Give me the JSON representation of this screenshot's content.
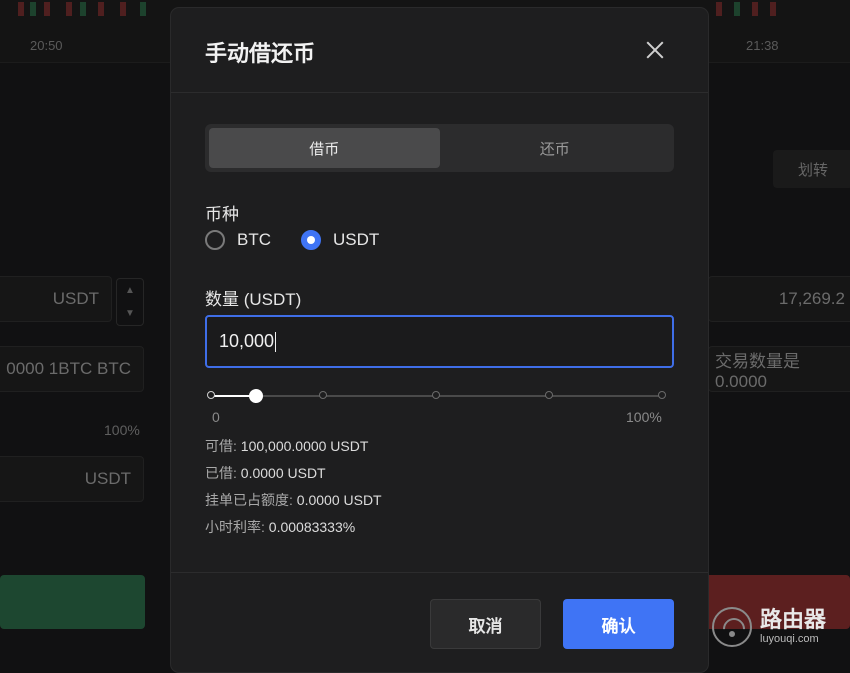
{
  "background": {
    "times": [
      "20:50",
      "21:38"
    ],
    "transfer_label": "划转",
    "rows": [
      {
        "left": "USDT",
        "right": "17,269.2"
      },
      {
        "left": "0000 1BTC  BTC",
        "right": "交易数量是0.0000"
      },
      {
        "left": "100%"
      },
      {
        "left": "USDT"
      }
    ]
  },
  "modal": {
    "title": "手动借还币",
    "close_label": "×",
    "tabs": [
      {
        "label": "借币",
        "active": true
      },
      {
        "label": "还币",
        "active": false
      }
    ],
    "currency_label": "币种",
    "currencies": [
      {
        "label": "BTC",
        "selected": false
      },
      {
        "label": "USDT",
        "selected": true
      }
    ],
    "amount_label": "数量 (USDT)",
    "amount_value": "10,000",
    "slider": {
      "min_label": "0",
      "max_label": "100%",
      "value_fraction": 0.1
    },
    "info": {
      "borrowable_key": "可借:",
      "borrowable_value": "100,000.0000 USDT",
      "borrowed_key": "已借:",
      "borrowed_value": "0.0000 USDT",
      "order_used_key": "挂单已占额度:",
      "order_used_value": "0.0000 USDT",
      "hourly_rate_key": "小时利率:",
      "hourly_rate_value": "0.00083333%"
    },
    "cancel_label": "取消",
    "confirm_label": "确认"
  },
  "watermark": {
    "cn": "路由器",
    "en": "luyouqi.com"
  },
  "colors": {
    "accent": "#3f74f5",
    "modal_bg": "#1e1e1f"
  }
}
